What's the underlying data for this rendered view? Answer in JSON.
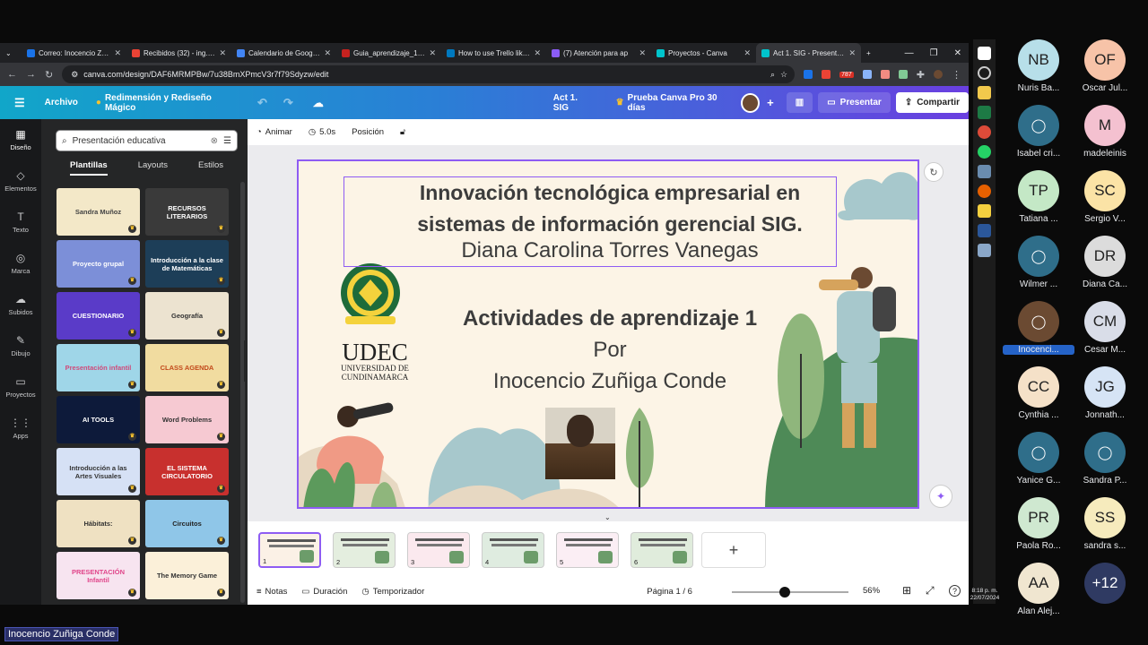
{
  "browser": {
    "tabs": [
      {
        "label": "Correo: Inocencio Zuñiga",
        "color": "#1a73e8"
      },
      {
        "label": "Recibidos (32) - ing.inoc",
        "color": "#ea4335"
      },
      {
        "label": "Calendario de Google -",
        "color": "#4285f4"
      },
      {
        "label": "Guia_aprendizaje_1.pdf",
        "color": "#c5221f"
      },
      {
        "label": "How to use Trello like a",
        "color": "#0079bf"
      },
      {
        "label": "(7) Atención para ap",
        "color": "#8b5cf6"
      },
      {
        "label": "Proyectos - Canva",
        "color": "#00c4cc"
      },
      {
        "label": "Act 1. SIG - Presentació",
        "color": "#00c4cc"
      }
    ],
    "new_tab": "+",
    "url": "canva.com/design/DAF6MRMPBw/7u38BmXPmcV3r7f79Sdyzw/edit",
    "ext_badge": "787"
  },
  "canva_top": {
    "menu": "☰",
    "archivo": "Archivo",
    "project": "Redimensión y Rediseño Mágico",
    "doc_title": "Act 1. SIG",
    "trial": "Prueba Canva Pro 30 días",
    "presentar": "Presentar",
    "compartir": "Compartir"
  },
  "rail": [
    {
      "label": "Diseño",
      "icon": "▦"
    },
    {
      "label": "Elementos",
      "icon": "◇"
    },
    {
      "label": "Texto",
      "icon": "T"
    },
    {
      "label": "Marca",
      "icon": "◎"
    },
    {
      "label": "Subidos",
      "icon": "☁"
    },
    {
      "label": "Dibujo",
      "icon": "✎"
    },
    {
      "label": "Proyectos",
      "icon": "▭"
    },
    {
      "label": "Apps",
      "icon": "⋮⋮"
    }
  ],
  "panel": {
    "search_value": "Presentación educativa",
    "tabs": [
      "Plantillas",
      "Layouts",
      "Estilos"
    ]
  },
  "templates": [
    {
      "label": "Sandra Muñoz",
      "bg": "#f3e8c8",
      "fg": "#444"
    },
    {
      "label": "RECURSOS LITERARIOS",
      "bg": "#3a3a3a",
      "fg": "#fff"
    },
    {
      "label": "Proyecto grupal",
      "bg": "#7c8fd8",
      "fg": "#fff"
    },
    {
      "label": "Introducción a la clase de Matemáticas",
      "bg": "#1d3e58",
      "fg": "#fff"
    },
    {
      "label": "CUESTIONARIO",
      "bg": "#5a3bc8",
      "fg": "#fff"
    },
    {
      "label": "Geografía",
      "bg": "#ece3d0",
      "fg": "#333"
    },
    {
      "label": "Presentación infantil",
      "bg": "#9fd6e8",
      "fg": "#d04a7a"
    },
    {
      "label": "CLASS AGENDA",
      "bg": "#f1dca0",
      "fg": "#c2491a"
    },
    {
      "label": "AI TOOLS",
      "bg": "#0d1a3a",
      "fg": "#fff"
    },
    {
      "label": "Word Problems",
      "bg": "#f6c9d2",
      "fg": "#333"
    },
    {
      "label": "Introducción a las Artes Visuales",
      "bg": "#d6e1f5",
      "fg": "#333"
    },
    {
      "label": "EL SISTEMA CIRCULATORIO",
      "bg": "#c8302e",
      "fg": "#fff"
    },
    {
      "label": "Hábitats:",
      "bg": "#efe1c2",
      "fg": "#333"
    },
    {
      "label": "Circuitos",
      "bg": "#8fc6e8",
      "fg": "#222"
    },
    {
      "label": "PRESENTACIÓN Infantil",
      "bg": "#f7e4f0",
      "fg": "#e0458a"
    },
    {
      "label": "The Memory Game",
      "bg": "#fbf0d9",
      "fg": "#333"
    }
  ],
  "toolbar": {
    "animar": "Animar",
    "duracion": "5.0s",
    "posicion": "Posición"
  },
  "slide": {
    "title_line1": "Innovación tecnológica empresarial en",
    "title_line2": "sistemas de información gerencial SIG.",
    "author": "Diana Carolina Torres Vanegas",
    "activity": "Actividades de aprendizaje 1",
    "por": "Por",
    "presenter": "Inocencio Zuñiga Conde",
    "udec_logo": "UDEC",
    "udec_name1": "UNIVERSIDAD DE",
    "udec_name2": "CUNDINAMARCA",
    "seal_text": "UNIVERSIDAD DE CUNDINAMARCA"
  },
  "pages": [
    "1",
    "2",
    "3",
    "4",
    "5",
    "6"
  ],
  "footer": {
    "notas": "Notas",
    "duracion": "Duración",
    "temporizador": "Temporizador",
    "pagina": "Página 1 / 6",
    "zoom": "56%",
    "zoom_value": 0.56
  },
  "participants": [
    {
      "initials": "NB",
      "name": "Nuris Ba...",
      "color": "#b7dfe9"
    },
    {
      "initials": "OF",
      "name": "Oscar Jul...",
      "color": "#f7c3a8"
    },
    {
      "initials": "",
      "name": "Isabel cri...",
      "color": "#2f6e8a"
    },
    {
      "initials": "M",
      "name": "madeleinis",
      "color": "#f4c1d0"
    },
    {
      "initials": "TP",
      "name": "Tatiana ...",
      "color": "#c4e8c6"
    },
    {
      "initials": "SC",
      "name": "Sergio V...",
      "color": "#fbe3a6"
    },
    {
      "initials": "",
      "name": "Wilmer ...",
      "color": "#2f6e8a"
    },
    {
      "initials": "DR",
      "name": "Diana Ca...",
      "color": "#dcdcdc"
    },
    {
      "initials": "",
      "name": "Inocenci...",
      "color": "#6b4a32"
    },
    {
      "initials": "CM",
      "name": "Cesar M...",
      "color": "#d9dde8"
    },
    {
      "initials": "CC",
      "name": "Cynthia ...",
      "color": "#f5e1c8"
    },
    {
      "initials": "JG",
      "name": "Jonnath...",
      "color": "#d6e4f5"
    },
    {
      "initials": "",
      "name": "Yanice G...",
      "color": "#2f6e8a"
    },
    {
      "initials": "",
      "name": "Sandra P...",
      "color": "#2f6e8a"
    },
    {
      "initials": "PR",
      "name": "Paola Ro...",
      "color": "#cfe8d0"
    },
    {
      "initials": "SS",
      "name": "sandra s...",
      "color": "#f6ebbd"
    },
    {
      "initials": "AA",
      "name": "Alan Alej...",
      "color": "#f0e6d0"
    },
    {
      "initials": "+12",
      "name": "",
      "color": "#2f3a62"
    }
  ],
  "clock": {
    "time": "8:18 p. m.",
    "date": "22/07/2024"
  },
  "speaker_name": "Inocencio Zuñiga Conde"
}
